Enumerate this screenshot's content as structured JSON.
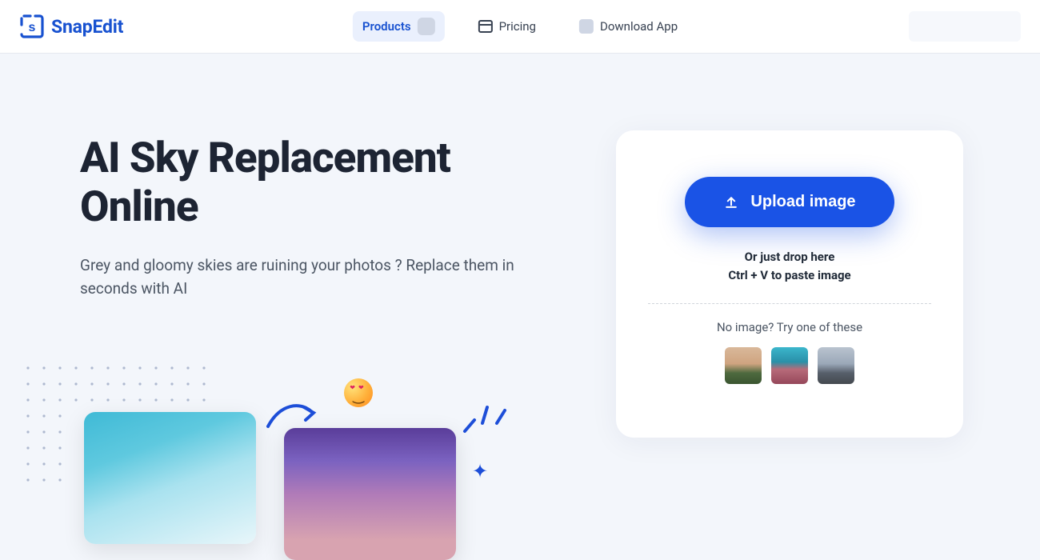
{
  "brand": {
    "name": "SnapEdit"
  },
  "nav": {
    "products": "Products",
    "pricing": "Pricing",
    "download": "Download App"
  },
  "hero": {
    "title_line1": "AI Sky Replacement",
    "title_line2": "Online",
    "subtitle": "Grey and gloomy skies are ruining your photos ? Replace them in seconds with AI"
  },
  "upload": {
    "button": "Upload image",
    "drop_line1": "Or just drop here",
    "drop_line2": "Ctrl + V to paste image",
    "try_label": "No image? Try one of these"
  }
}
